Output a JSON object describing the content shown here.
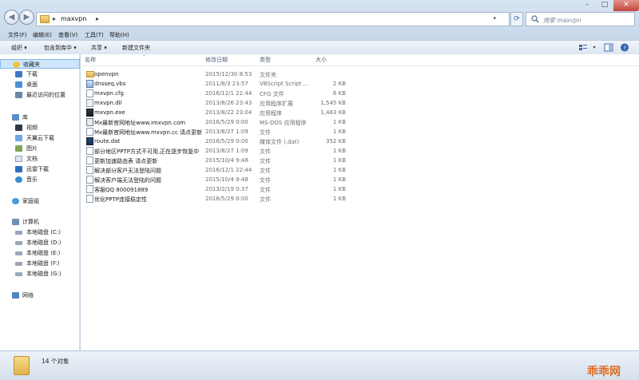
{
  "window": {
    "controls": {
      "minimize": "–",
      "maximize": "□",
      "close": "✕"
    }
  },
  "nav": {
    "back": "◀",
    "forward": "▶",
    "refresh": "⟳"
  },
  "address": {
    "crumb": "maxvpn",
    "sep": "▸",
    "dropdown": "▾"
  },
  "search": {
    "placeholder": "搜索 maxvpn"
  },
  "menu": [
    {
      "label": "文件(F)"
    },
    {
      "label": "编辑(E)"
    },
    {
      "label": "查看(V)"
    },
    {
      "label": "工具(T)"
    },
    {
      "label": "帮助(H)"
    }
  ],
  "toolbar": {
    "organize": "组织 ▾",
    "include_library": "包含到库中 ▾",
    "share": "共享 ▾",
    "new_folder": "新建文件夹"
  },
  "sidebar": {
    "favorites": {
      "label": "收藏夹",
      "items": [
        {
          "label": "下载"
        },
        {
          "label": "桌面"
        },
        {
          "label": "最近访问的位置"
        }
      ]
    },
    "libraries": {
      "label": "库",
      "items": [
        {
          "label": "视频"
        },
        {
          "label": "天翼云下载"
        },
        {
          "label": "图片"
        },
        {
          "label": "文档"
        },
        {
          "label": "迅雷下载"
        },
        {
          "label": "音乐"
        }
      ]
    },
    "homegroup": {
      "label": "家庭组"
    },
    "computer": {
      "label": "计算机",
      "items": [
        {
          "label": "本地磁盘 (C:)"
        },
        {
          "label": "本地磁盘 (D:)"
        },
        {
          "label": "本地磁盘 (E:)"
        },
        {
          "label": "本地磁盘 (F:)"
        },
        {
          "label": "本地磁盘 (G:)"
        }
      ]
    },
    "network": {
      "label": "网络"
    }
  },
  "columns": {
    "name": "名称",
    "date": "修改日期",
    "type": "类型",
    "size": "大小",
    "sort_indicator": "⌃"
  },
  "files": [
    {
      "icon": "folder-icon",
      "name": "openvpn",
      "date": "2015/12/30 8:53",
      "type": "文件夹",
      "size": ""
    },
    {
      "icon": "vbs-icon",
      "name": "dnsseq.vbs",
      "date": "2011/8/3 23:57",
      "type": "VBScript Script ...",
      "size": "2 KB"
    },
    {
      "icon": "txt-icon",
      "name": "mxvpn.cfg",
      "date": "2016/12/1 22:44",
      "type": "CFG 文件",
      "size": "6 KB"
    },
    {
      "icon": "dll-icon",
      "name": "mxvpn.dll",
      "date": "2013/8/26 23:43",
      "type": "应用程序扩展",
      "size": "1,545 KB"
    },
    {
      "icon": "exe-icon",
      "name": "mxvpn.exe",
      "date": "2013/8/22 23:04",
      "type": "应用程序",
      "size": "1,483 KB"
    },
    {
      "icon": "bat-icon",
      "name": "Mx最新官网地址www.imxvpn.com",
      "date": "2016/5/29 0:00",
      "type": "MS-DOS 应用程序",
      "size": "1 KB"
    },
    {
      "icon": "txt-icon",
      "name": "Mx最新官网地址www.mxvpn.cc 请点更新",
      "date": "2013/8/27 1:09",
      "type": "文件",
      "size": "1 KB"
    },
    {
      "icon": "dat-icon",
      "name": "route.dat",
      "date": "2016/5/29 0:00",
      "type": "媒体文件 (.dat)",
      "size": "352 KB"
    },
    {
      "icon": "txt-icon",
      "name": "部分地区PPTP方式不可用,正在逐步恢复中",
      "date": "2013/8/27 1:09",
      "type": "文件",
      "size": "1 KB"
    },
    {
      "icon": "txt-icon",
      "name": "更新加速路由表 请点更新",
      "date": "2015/10/4 9:48",
      "type": "文件",
      "size": "1 KB"
    },
    {
      "icon": "txt-icon",
      "name": "解决部分客户无法登陆问题",
      "date": "2016/12/1 22:44",
      "type": "文件",
      "size": "1 KB"
    },
    {
      "icon": "txt-icon",
      "name": "解决客户端无法登陆的问题",
      "date": "2015/10/4 9:48",
      "type": "文件",
      "size": "1 KB"
    },
    {
      "icon": "txt-icon",
      "name": "客服QQ 800091889",
      "date": "2013/2/19 0:37",
      "type": "文件",
      "size": "1 KB"
    },
    {
      "icon": "txt-icon",
      "name": "优化PPTP连接稳定性",
      "date": "2016/5/29 0:00",
      "type": "文件",
      "size": "1 KB"
    }
  ],
  "status": {
    "count": "14 个对象"
  },
  "watermark": "乖乖网"
}
